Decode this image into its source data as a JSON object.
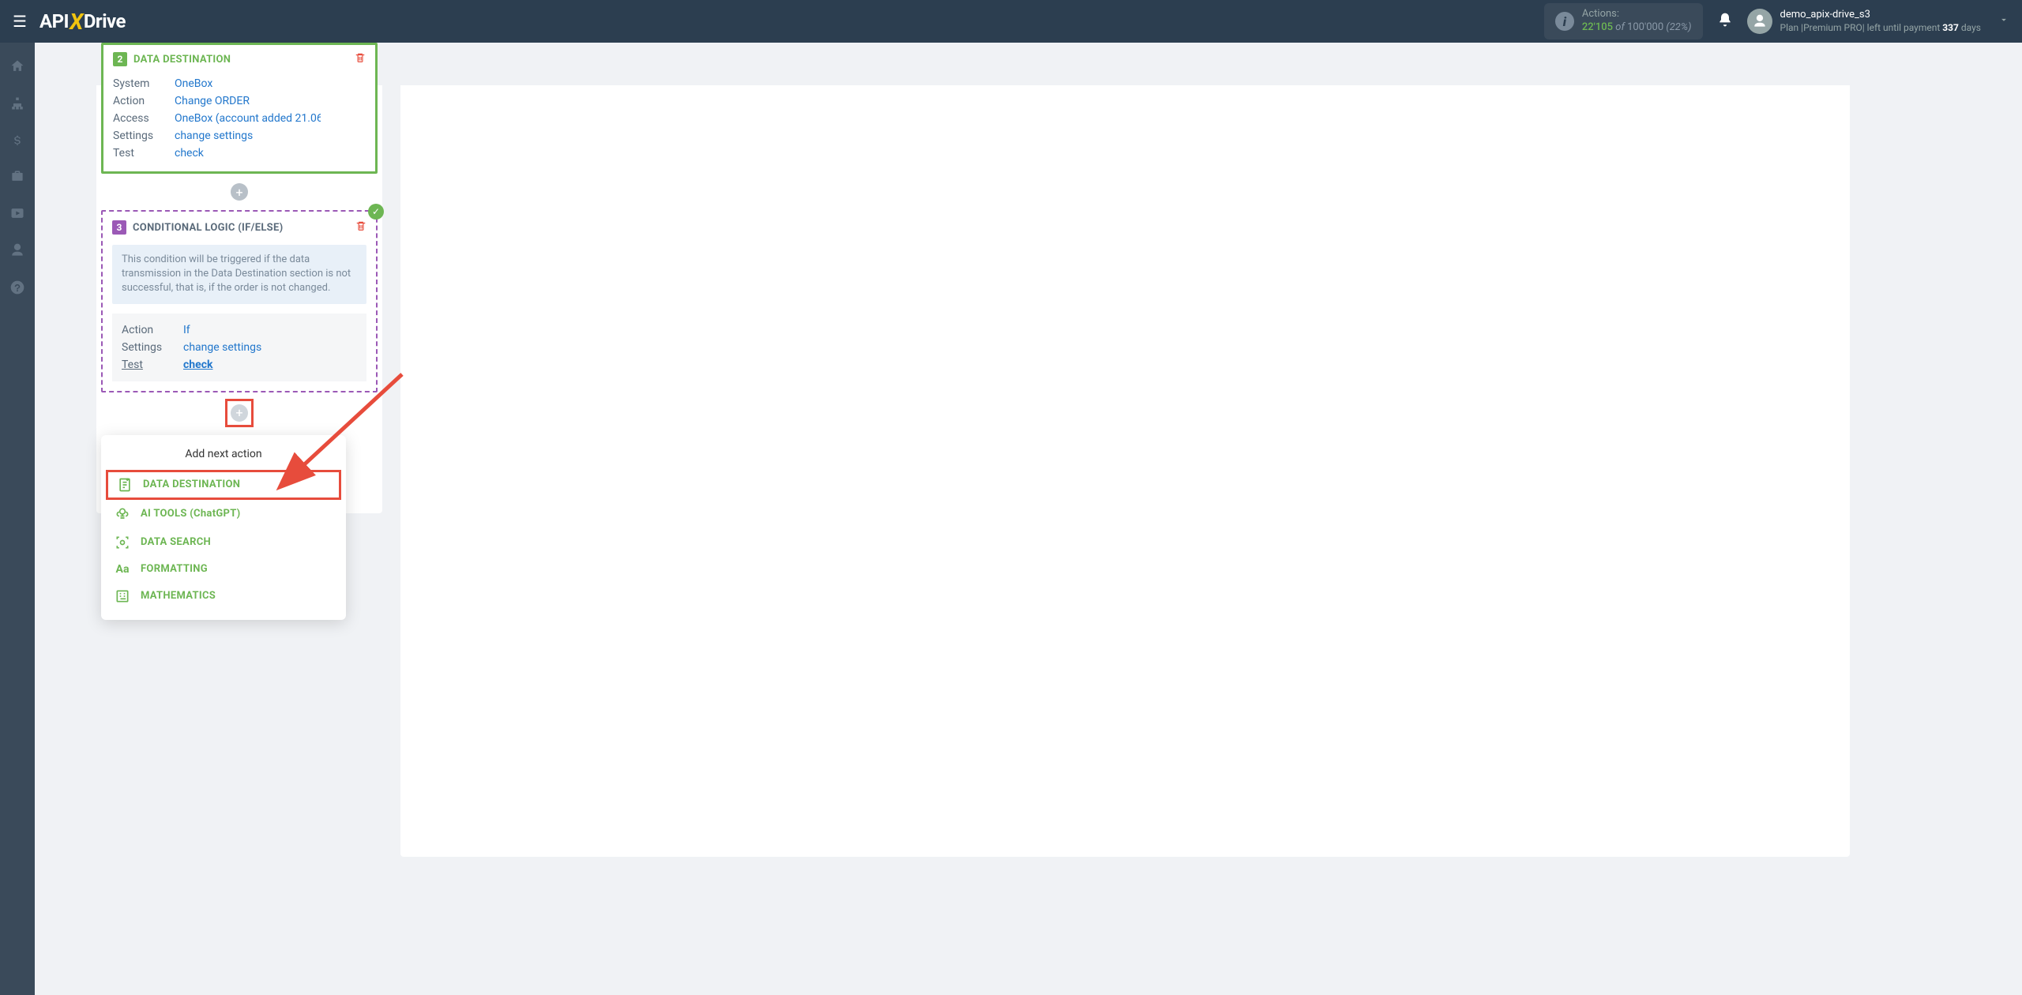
{
  "header": {
    "logo_api": "API",
    "logo_x": "X",
    "logo_drive": "Drive",
    "actions_label": "Actions:",
    "actions_count": "22'105",
    "actions_of": "of",
    "actions_total": "100'000",
    "actions_pct": "(22%)",
    "user_name": "demo_apix-drive_s3",
    "plan_prefix": "Plan |",
    "plan_name": "Premium PRO",
    "plan_mid": "| left until payment ",
    "plan_days": "337",
    "plan_suffix": " days"
  },
  "step2": {
    "num": "2",
    "title": "DATA DESTINATION",
    "rows": {
      "system_k": "System",
      "system_v": "OneBox",
      "action_k": "Action",
      "action_v": "Change ORDER",
      "access_k": "Access",
      "access_v": "OneBox (account added 21.06",
      "settings_k": "Settings",
      "settings_v": "change settings",
      "test_k": "Test",
      "test_v": "check"
    }
  },
  "step3": {
    "num": "3",
    "title": "CONDITIONAL LOGIC (IF/ELSE)",
    "desc": "This condition will be triggered if the data transmission in the Data Destination section is not successful, that is, if the order is not changed.",
    "rows": {
      "action_k": "Action",
      "action_v": "If",
      "settings_k": "Settings",
      "settings_v": "change settings",
      "test_k": "Test",
      "test_v": "check"
    }
  },
  "dropdown": {
    "title": "Add next action",
    "items": {
      "dest": "DATA DESTINATION",
      "ai": "AI TOOLS (ChatGPT)",
      "search": "DATA SEARCH",
      "format": "FORMATTING",
      "math": "MATHEMATICS"
    }
  }
}
